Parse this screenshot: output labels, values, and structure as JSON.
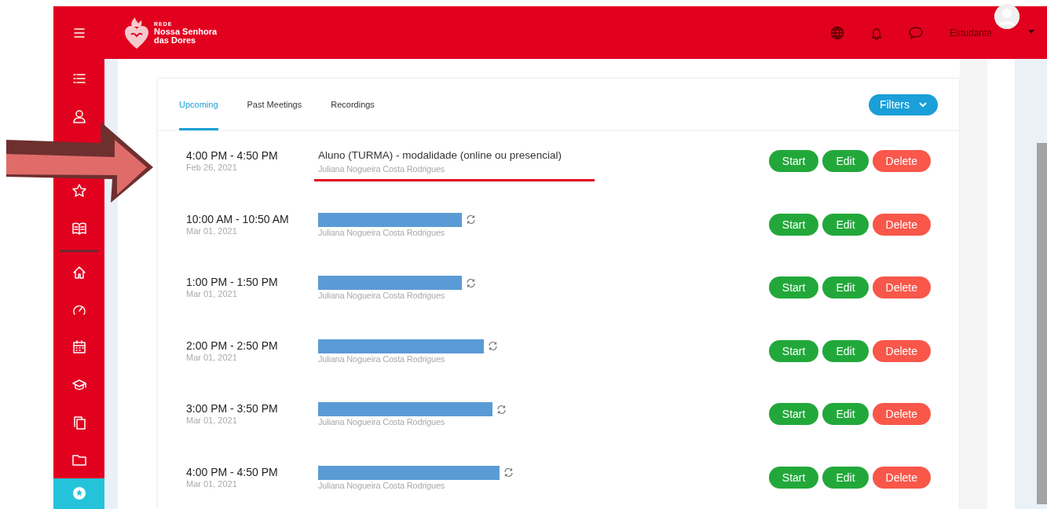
{
  "header": {
    "brand_small": "REDE",
    "brand_line1": "Nossa Senhora",
    "brand_line2": "das Dores",
    "user": "Estudante"
  },
  "tabs": [
    {
      "label": "Upcoming",
      "selected": true
    },
    {
      "label": "Past Meetings",
      "selected": false
    },
    {
      "label": "Recordings",
      "selected": false
    }
  ],
  "filters_button": "Filters",
  "meetings": [
    {
      "time": "4:00 PM - 4:50 PM",
      "date": "Feb 26, 2021",
      "title": "Aluno (TURMA) - modalidade (online ou presencial)",
      "host": "Juliana Nogueira Costa Rodrigues",
      "redacted": false,
      "underlined": true,
      "actions": [
        {
          "label": "Start",
          "kind": "start"
        },
        {
          "label": "Edit",
          "kind": "edit"
        },
        {
          "label": "Delete",
          "kind": "delete"
        }
      ]
    },
    {
      "time": "10:00 AM - 10:50 AM",
      "date": "Mar 01, 2021",
      "host": "Juliana Nogueira Costa Rodrigues",
      "redacted": true,
      "underlined": false,
      "actions": [
        {
          "label": "Start",
          "kind": "start"
        },
        {
          "label": "Edit",
          "kind": "edit"
        },
        {
          "label": "Delete",
          "kind": "delete"
        }
      ]
    },
    {
      "time": "1:00 PM - 1:50 PM",
      "date": "Mar 01, 2021",
      "host": "Juliana Nogueira Costa Rodrigues",
      "redacted": true,
      "underlined": false,
      "actions": [
        {
          "label": "Start",
          "kind": "start"
        },
        {
          "label": "Edit",
          "kind": "edit"
        },
        {
          "label": "Delete",
          "kind": "delete"
        }
      ]
    },
    {
      "time": "2:00 PM - 2:50 PM",
      "date": "Mar 01, 2021",
      "host": "Juliana Nogueira Costa Rodrigues",
      "redacted": true,
      "underlined": false,
      "actions": [
        {
          "label": "Start",
          "kind": "start"
        },
        {
          "label": "Edit",
          "kind": "edit"
        },
        {
          "label": "Delete",
          "kind": "delete"
        }
      ]
    },
    {
      "time": "3:00 PM - 3:50 PM",
      "date": "Mar 01, 2021",
      "host": "Juliana Nogueira Costa Rodrigues",
      "redacted": true,
      "underlined": false,
      "actions": [
        {
          "label": "Start",
          "kind": "start"
        },
        {
          "label": "Edit",
          "kind": "edit"
        },
        {
          "label": "Delete",
          "kind": "delete"
        }
      ]
    },
    {
      "time": "4:00 PM - 4:50 PM",
      "date": "Mar 01, 2021",
      "host": "Juliana Nogueira Costa Rodrigues",
      "redacted": true,
      "underlined": false,
      "actions": [
        {
          "label": "Start",
          "kind": "start"
        },
        {
          "label": "Edit",
          "kind": "edit"
        },
        {
          "label": "Delete",
          "kind": "delete"
        }
      ]
    }
  ]
}
